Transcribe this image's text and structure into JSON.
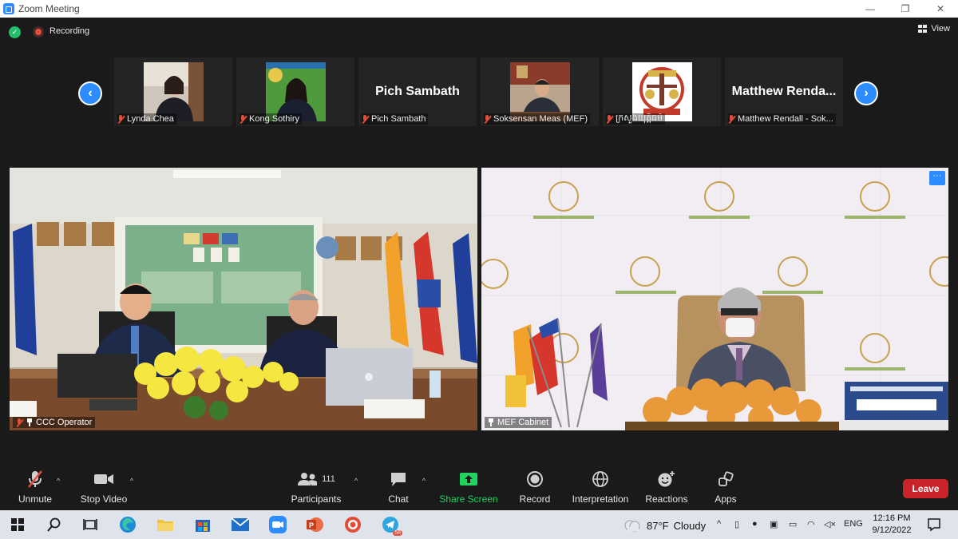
{
  "window": {
    "title": "Zoom Meeting",
    "controls": [
      "—",
      "❐",
      "✕"
    ]
  },
  "status": {
    "recording_label": "Recording",
    "view_label": "View"
  },
  "participants_strip": [
    {
      "name": "Lynda Chea",
      "type": "video"
    },
    {
      "name": "Kong Sothiry",
      "type": "video"
    },
    {
      "name": "Pich Sambath",
      "type": "name",
      "display": "Pich Sambath"
    },
    {
      "name": "Soksensan Meas (MEF)",
      "type": "video"
    },
    {
      "name": "ក្រសួងយុត្តិធម៌",
      "type": "logo"
    },
    {
      "name": "Matthew Rendall - Sok...",
      "type": "name",
      "display": "Matthew  Renda..."
    }
  ],
  "main_videos": [
    {
      "label": "CCC Operator"
    },
    {
      "label": "MEF Cabinet"
    }
  ],
  "toolbar": {
    "unmute": "Unmute",
    "stop_video": "Stop Video",
    "participants": "Participants",
    "participant_count": "111",
    "chat": "Chat",
    "share_screen": "Share Screen",
    "record": "Record",
    "interpretation": "Interpretation",
    "reactions": "Reactions",
    "apps": "Apps",
    "leave": "Leave"
  },
  "taskbar": {
    "weather": {
      "temp": "87°F",
      "condition": "Cloudy"
    },
    "language": "ENG",
    "time": "12:16 PM",
    "date": "9/12/2022",
    "telegram_badge": "58"
  },
  "colors": {
    "accent": "#2d8cff",
    "share_green": "#23d15f",
    "leave_red": "#c8242a"
  }
}
